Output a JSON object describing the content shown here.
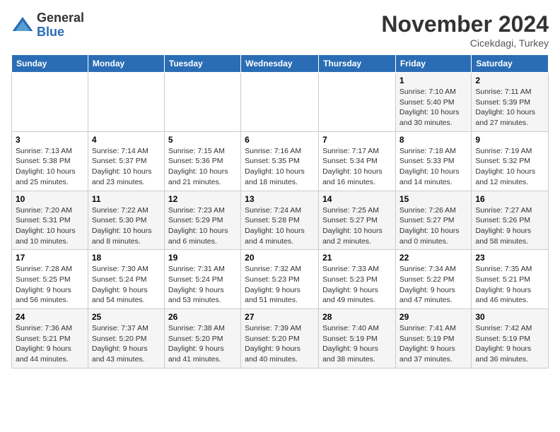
{
  "header": {
    "logo_general": "General",
    "logo_blue": "Blue",
    "month": "November 2024",
    "location": "Cicekdagi, Turkey"
  },
  "weekdays": [
    "Sunday",
    "Monday",
    "Tuesday",
    "Wednesday",
    "Thursday",
    "Friday",
    "Saturday"
  ],
  "weeks": [
    [
      {
        "day": "",
        "info": ""
      },
      {
        "day": "",
        "info": ""
      },
      {
        "day": "",
        "info": ""
      },
      {
        "day": "",
        "info": ""
      },
      {
        "day": "",
        "info": ""
      },
      {
        "day": "1",
        "info": "Sunrise: 7:10 AM\nSunset: 5:40 PM\nDaylight: 10 hours and 30 minutes."
      },
      {
        "day": "2",
        "info": "Sunrise: 7:11 AM\nSunset: 5:39 PM\nDaylight: 10 hours and 27 minutes."
      }
    ],
    [
      {
        "day": "3",
        "info": "Sunrise: 7:13 AM\nSunset: 5:38 PM\nDaylight: 10 hours and 25 minutes."
      },
      {
        "day": "4",
        "info": "Sunrise: 7:14 AM\nSunset: 5:37 PM\nDaylight: 10 hours and 23 minutes."
      },
      {
        "day": "5",
        "info": "Sunrise: 7:15 AM\nSunset: 5:36 PM\nDaylight: 10 hours and 21 minutes."
      },
      {
        "day": "6",
        "info": "Sunrise: 7:16 AM\nSunset: 5:35 PM\nDaylight: 10 hours and 18 minutes."
      },
      {
        "day": "7",
        "info": "Sunrise: 7:17 AM\nSunset: 5:34 PM\nDaylight: 10 hours and 16 minutes."
      },
      {
        "day": "8",
        "info": "Sunrise: 7:18 AM\nSunset: 5:33 PM\nDaylight: 10 hours and 14 minutes."
      },
      {
        "day": "9",
        "info": "Sunrise: 7:19 AM\nSunset: 5:32 PM\nDaylight: 10 hours and 12 minutes."
      }
    ],
    [
      {
        "day": "10",
        "info": "Sunrise: 7:20 AM\nSunset: 5:31 PM\nDaylight: 10 hours and 10 minutes."
      },
      {
        "day": "11",
        "info": "Sunrise: 7:22 AM\nSunset: 5:30 PM\nDaylight: 10 hours and 8 minutes."
      },
      {
        "day": "12",
        "info": "Sunrise: 7:23 AM\nSunset: 5:29 PM\nDaylight: 10 hours and 6 minutes."
      },
      {
        "day": "13",
        "info": "Sunrise: 7:24 AM\nSunset: 5:28 PM\nDaylight: 10 hours and 4 minutes."
      },
      {
        "day": "14",
        "info": "Sunrise: 7:25 AM\nSunset: 5:27 PM\nDaylight: 10 hours and 2 minutes."
      },
      {
        "day": "15",
        "info": "Sunrise: 7:26 AM\nSunset: 5:27 PM\nDaylight: 10 hours and 0 minutes."
      },
      {
        "day": "16",
        "info": "Sunrise: 7:27 AM\nSunset: 5:26 PM\nDaylight: 9 hours and 58 minutes."
      }
    ],
    [
      {
        "day": "17",
        "info": "Sunrise: 7:28 AM\nSunset: 5:25 PM\nDaylight: 9 hours and 56 minutes."
      },
      {
        "day": "18",
        "info": "Sunrise: 7:30 AM\nSunset: 5:24 PM\nDaylight: 9 hours and 54 minutes."
      },
      {
        "day": "19",
        "info": "Sunrise: 7:31 AM\nSunset: 5:24 PM\nDaylight: 9 hours and 53 minutes."
      },
      {
        "day": "20",
        "info": "Sunrise: 7:32 AM\nSunset: 5:23 PM\nDaylight: 9 hours and 51 minutes."
      },
      {
        "day": "21",
        "info": "Sunrise: 7:33 AM\nSunset: 5:23 PM\nDaylight: 9 hours and 49 minutes."
      },
      {
        "day": "22",
        "info": "Sunrise: 7:34 AM\nSunset: 5:22 PM\nDaylight: 9 hours and 47 minutes."
      },
      {
        "day": "23",
        "info": "Sunrise: 7:35 AM\nSunset: 5:21 PM\nDaylight: 9 hours and 46 minutes."
      }
    ],
    [
      {
        "day": "24",
        "info": "Sunrise: 7:36 AM\nSunset: 5:21 PM\nDaylight: 9 hours and 44 minutes."
      },
      {
        "day": "25",
        "info": "Sunrise: 7:37 AM\nSunset: 5:20 PM\nDaylight: 9 hours and 43 minutes."
      },
      {
        "day": "26",
        "info": "Sunrise: 7:38 AM\nSunset: 5:20 PM\nDaylight: 9 hours and 41 minutes."
      },
      {
        "day": "27",
        "info": "Sunrise: 7:39 AM\nSunset: 5:20 PM\nDaylight: 9 hours and 40 minutes."
      },
      {
        "day": "28",
        "info": "Sunrise: 7:40 AM\nSunset: 5:19 PM\nDaylight: 9 hours and 38 minutes."
      },
      {
        "day": "29",
        "info": "Sunrise: 7:41 AM\nSunset: 5:19 PM\nDaylight: 9 hours and 37 minutes."
      },
      {
        "day": "30",
        "info": "Sunrise: 7:42 AM\nSunset: 5:19 PM\nDaylight: 9 hours and 36 minutes."
      }
    ]
  ]
}
